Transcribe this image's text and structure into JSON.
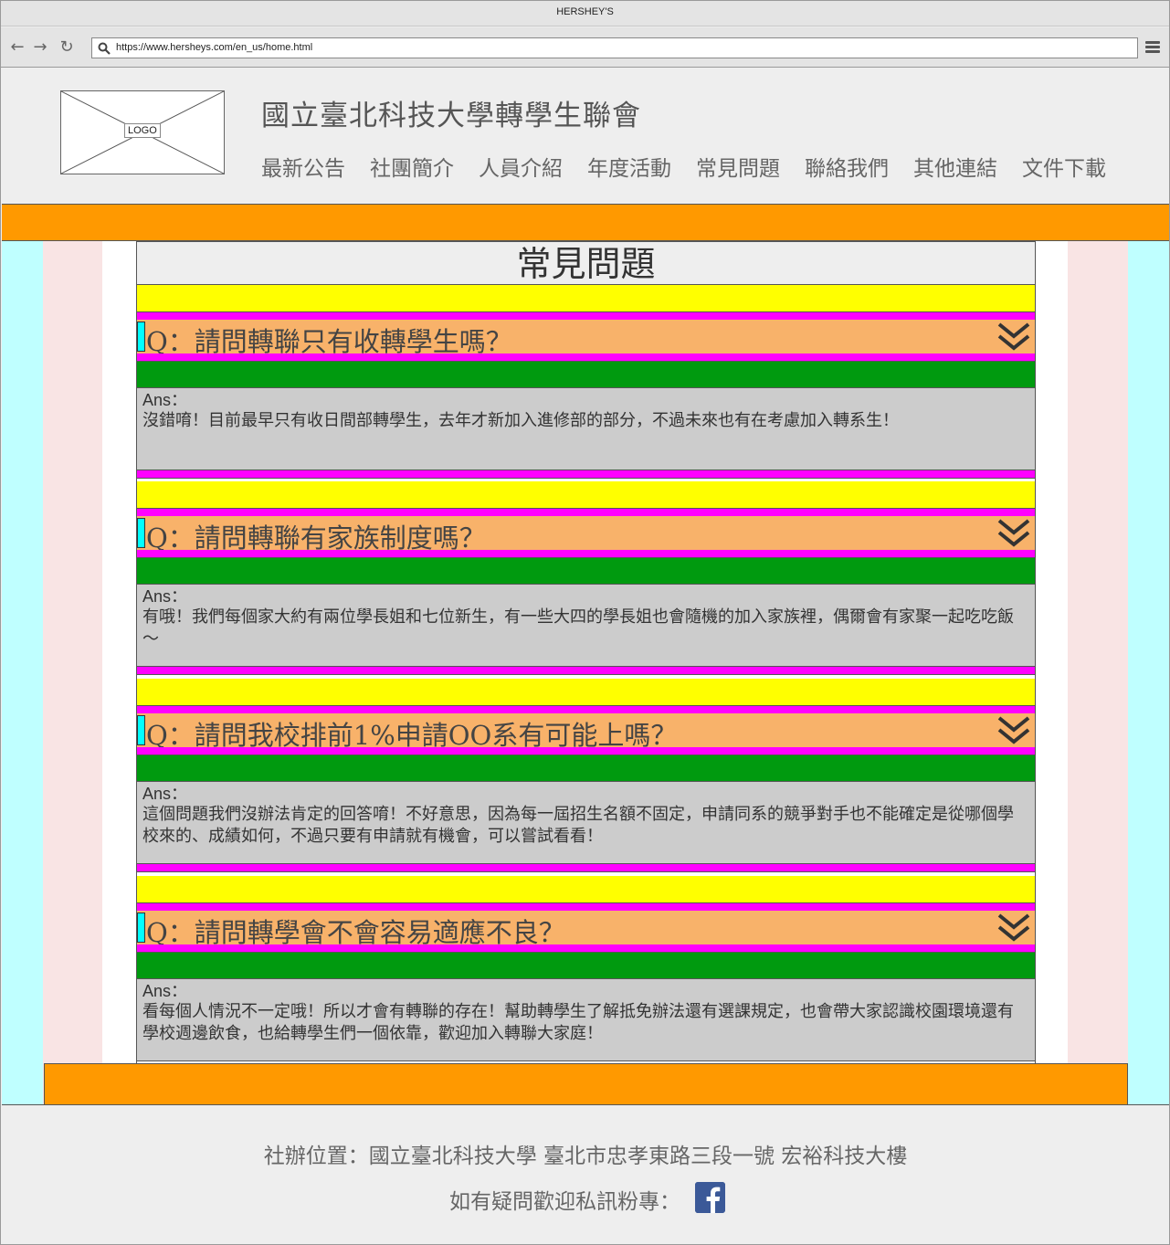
{
  "browser": {
    "title": "HERSHEY'S",
    "url": "https://www.hersheys.com/en_us/home.html",
    "back_icon": "←",
    "forward_icon": "→",
    "reload_icon": "↻"
  },
  "header": {
    "logo_label": "LOGO",
    "site_title": "國立臺北科技大學轉學生聯會",
    "nav": [
      "最新公告",
      "社團簡介",
      "人員介紹",
      "年度活動",
      "常見問題",
      "聯絡我們",
      "其他連結",
      "文件下載"
    ]
  },
  "main": {
    "heading": "常見問題",
    "faqs": [
      {
        "question": "Q：請問轉聯只有收轉學生嗎？",
        "answer_label": "Ans：",
        "answer": "沒錯唷！目前最早只有收日間部轉學生，去年才新加入進修部的部分，不過未來也有在考慮加入轉系生！"
      },
      {
        "question": "Q：請問轉聯有家族制度嗎？",
        "answer_label": "Ans：",
        "answer": "有哦！我們每個家大約有兩位學長姐和七位新生，有一些大四的學長姐也會隨機的加入家族裡，偶爾會有家聚一起吃吃飯～"
      },
      {
        "question": "Q：請問我校排前1%申請OO系有可能上嗎？",
        "answer_label": "Ans：",
        "answer": "這個問題我們沒辦法肯定的回答唷！不好意思，因為每一屆招生名額不固定，申請同系的競爭對手也不能確定是從哪個學校來的、成績如何，不過只要有申請就有機會，可以嘗試看看！"
      },
      {
        "question": "Q：請問轉學會不會容易適應不良？",
        "answer_label": "Ans：",
        "answer": "看每個人情況不一定哦！所以才會有轉聯的存在！幫助轉學生了解抵免辦法還有選課規定，也會帶大家認識校園環境還有學校週邊飲食，也給轉學生們一個依靠，歡迎加入轉聯大家庭！"
      }
    ]
  },
  "footer": {
    "address": "社辦位置：國立臺北科技大學  臺北市忠孝東路三段一號  宏裕科技大樓",
    "contact": "如有疑問歡迎私訊粉專：",
    "fb_icon": "facebook-icon"
  },
  "colors": {
    "orange": "#ff9900",
    "yellow": "#ffff00",
    "magenta": "#ff00ff",
    "green": "#009a0f",
    "question_bg": "#f8b26a",
    "answer_bg": "#cccccc",
    "cyan": "#bfffff",
    "pink": "#f9e4e4"
  }
}
